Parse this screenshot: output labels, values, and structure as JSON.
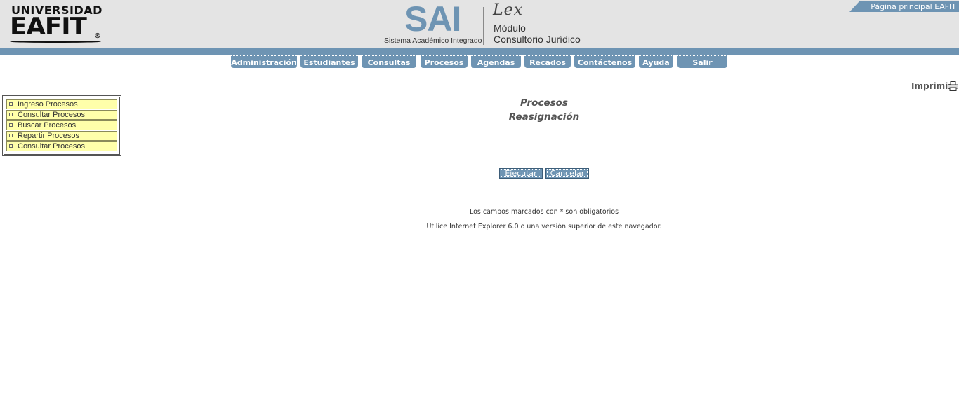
{
  "header": {
    "logo_line1": "UNIVERSIDAD",
    "logo_line2": "EAFIT",
    "logo_reg": "®",
    "sai_title": "SAI",
    "sai_subtitle": "Sistema Académico Integrado",
    "lex_word": "Lex",
    "module_line1": "Módulo",
    "module_line2": "Consultorio Jurídico",
    "home_link": "Página principal EAFIT",
    "accent_color": "#6e94b3"
  },
  "nav": {
    "tabs": [
      {
        "label": "Administración"
      },
      {
        "label": "Estudiantes"
      },
      {
        "label": "Consultas"
      },
      {
        "label": "Procesos"
      },
      {
        "label": "Agendas"
      },
      {
        "label": "Recados"
      },
      {
        "label": "Contáctenos"
      },
      {
        "label": "Ayuda"
      },
      {
        "label": "Salir"
      }
    ]
  },
  "print": {
    "label": "Imprimir",
    "icon": "printer-icon"
  },
  "side_menu": {
    "items": [
      {
        "label": "Ingreso Procesos"
      },
      {
        "label": "Consultar Procesos"
      },
      {
        "label": "Buscar Procesos"
      },
      {
        "label": "Repartir Procesos"
      },
      {
        "label": "Consultar Procesos"
      }
    ]
  },
  "main": {
    "title": "Procesos",
    "subtitle": "Reasignación",
    "execute_button": "Ejecutar",
    "cancel_button": "Cancelar",
    "required_note": "Los campos marcados con * son obligatorios",
    "browser_note": "Utilice Internet Explorer 6.0 o una versión superior de este navegador."
  }
}
